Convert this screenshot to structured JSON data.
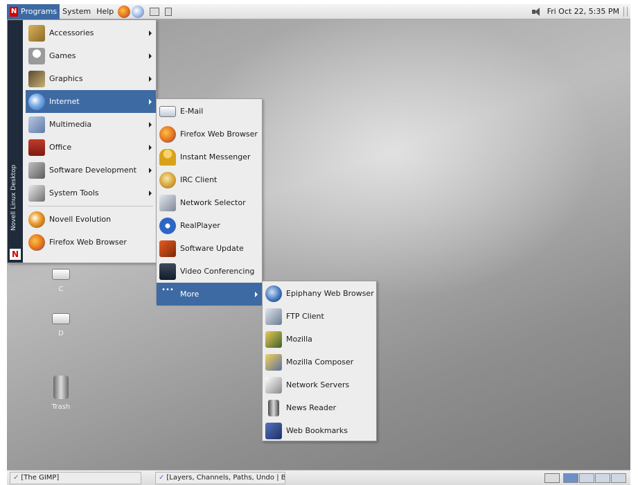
{
  "top_panel": {
    "logo_letter": "N",
    "programs_label": "Programs",
    "system_label": "System",
    "help_label": "Help",
    "clock": "Fri Oct 22,  5:35 PM"
  },
  "programs_menu": {
    "banner_text": "Novell Linux Desktop",
    "banner_letter": "N",
    "items": [
      {
        "label": "Accessories",
        "icon": "accessories-icon",
        "submenu": true
      },
      {
        "label": "Games",
        "icon": "games-icon",
        "submenu": true
      },
      {
        "label": "Graphics",
        "icon": "graphics-icon",
        "submenu": true
      },
      {
        "label": "Internet",
        "icon": "internet-globe-icon",
        "submenu": true,
        "highlighted": true
      },
      {
        "label": "Multimedia",
        "icon": "multimedia-icon",
        "submenu": true
      },
      {
        "label": "Office",
        "icon": "office-icon",
        "submenu": true
      },
      {
        "label": "Software Development",
        "icon": "software-development-icon",
        "submenu": true
      },
      {
        "label": "System Tools",
        "icon": "system-tools-icon",
        "submenu": true
      },
      {
        "label": "Novell Evolution",
        "icon": "evolution-icon",
        "submenu": false
      },
      {
        "label": "Firefox Web Browser",
        "icon": "firefox-icon",
        "submenu": false
      }
    ]
  },
  "internet_menu": {
    "items": [
      {
        "label": "E-Mail",
        "icon": "email-icon"
      },
      {
        "label": "Firefox Web Browser",
        "icon": "firefox-icon"
      },
      {
        "label": "Instant Messenger",
        "icon": "instant-messenger-icon"
      },
      {
        "label": "IRC Client",
        "icon": "irc-client-icon"
      },
      {
        "label": "Network Selector",
        "icon": "network-selector-icon"
      },
      {
        "label": "RealPlayer",
        "icon": "realplayer-icon"
      },
      {
        "label": "Software Update",
        "icon": "software-update-icon"
      },
      {
        "label": "Video Conferencing",
        "icon": "video-conferencing-icon"
      },
      {
        "label": "More",
        "icon": "more-icon",
        "submenu": true,
        "highlighted": true
      }
    ]
  },
  "more_menu": {
    "items": [
      {
        "label": "Epiphany Web Browser",
        "icon": "epiphany-icon"
      },
      {
        "label": "FTP Client",
        "icon": "ftp-client-icon"
      },
      {
        "label": "Mozilla",
        "icon": "mozilla-icon"
      },
      {
        "label": "Mozilla Composer",
        "icon": "mozilla-composer-icon"
      },
      {
        "label": "Network Servers",
        "icon": "network-servers-icon"
      },
      {
        "label": "News Reader",
        "icon": "news-reader-icon"
      },
      {
        "label": "Web Bookmarks",
        "icon": "web-bookmarks-icon"
      }
    ]
  },
  "desktop_icons": [
    {
      "label": "C",
      "icon": "drive-icon"
    },
    {
      "label": "D",
      "icon": "drive-icon"
    },
    {
      "label": "Trash",
      "icon": "trash-icon"
    }
  ],
  "taskbar": {
    "tasks": [
      {
        "label": "[The GIMP]"
      },
      {
        "label": "[Layers, Channels, Paths, Undo | B"
      }
    ]
  },
  "colors": {
    "highlight": "#3e6aa3",
    "menu_bg": "#ededed",
    "banner_bg": "#1f2b3a"
  }
}
